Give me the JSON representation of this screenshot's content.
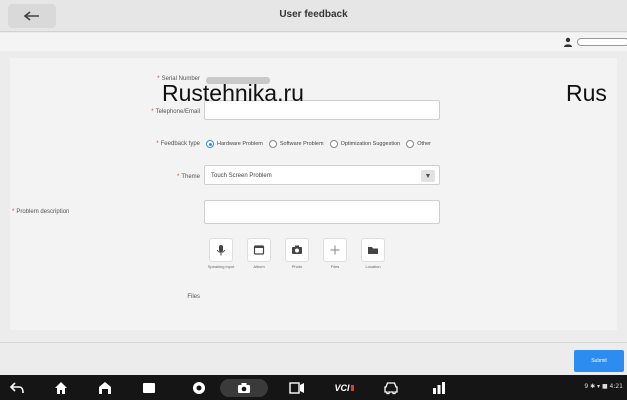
{
  "header": {
    "title": "User feedback"
  },
  "form": {
    "serial_label": "Serial Number",
    "serial_value": "",
    "contact_label": "Telephone/Email",
    "contact_value": "",
    "feedback_type_label": "Feedback type",
    "feedback_types": [
      {
        "label": "Hardware Problem",
        "checked": true
      },
      {
        "label": "Software Problem",
        "checked": false
      },
      {
        "label": "Optimization Suggestion",
        "checked": false
      },
      {
        "label": "Other",
        "checked": false
      }
    ],
    "theme_label": "Theme",
    "theme_value": "Touch Screen Problem",
    "description_label": "Problem description",
    "description_value": "",
    "attachments": [
      {
        "label": "Speaking input",
        "icon": "mic-icon"
      },
      {
        "label": "Album",
        "icon": "album-icon"
      },
      {
        "label": "Photo",
        "icon": "camera-icon"
      },
      {
        "label": "Files",
        "icon": "plus-icon"
      },
      {
        "label": "Location",
        "icon": "folder-icon"
      }
    ],
    "files_label": "Files"
  },
  "watermark": {
    "text1": "Rustehnika.ru",
    "text2": "Rus"
  },
  "footer": {
    "submit_label": "Submit"
  },
  "navbar": {
    "vci_label": "VCI",
    "status_text": "9 ✱ ▾ ■ 4:21"
  },
  "colors": {
    "accent": "#2d8cf0",
    "navbar_bg": "#151515",
    "vci_red": "#e53935"
  }
}
